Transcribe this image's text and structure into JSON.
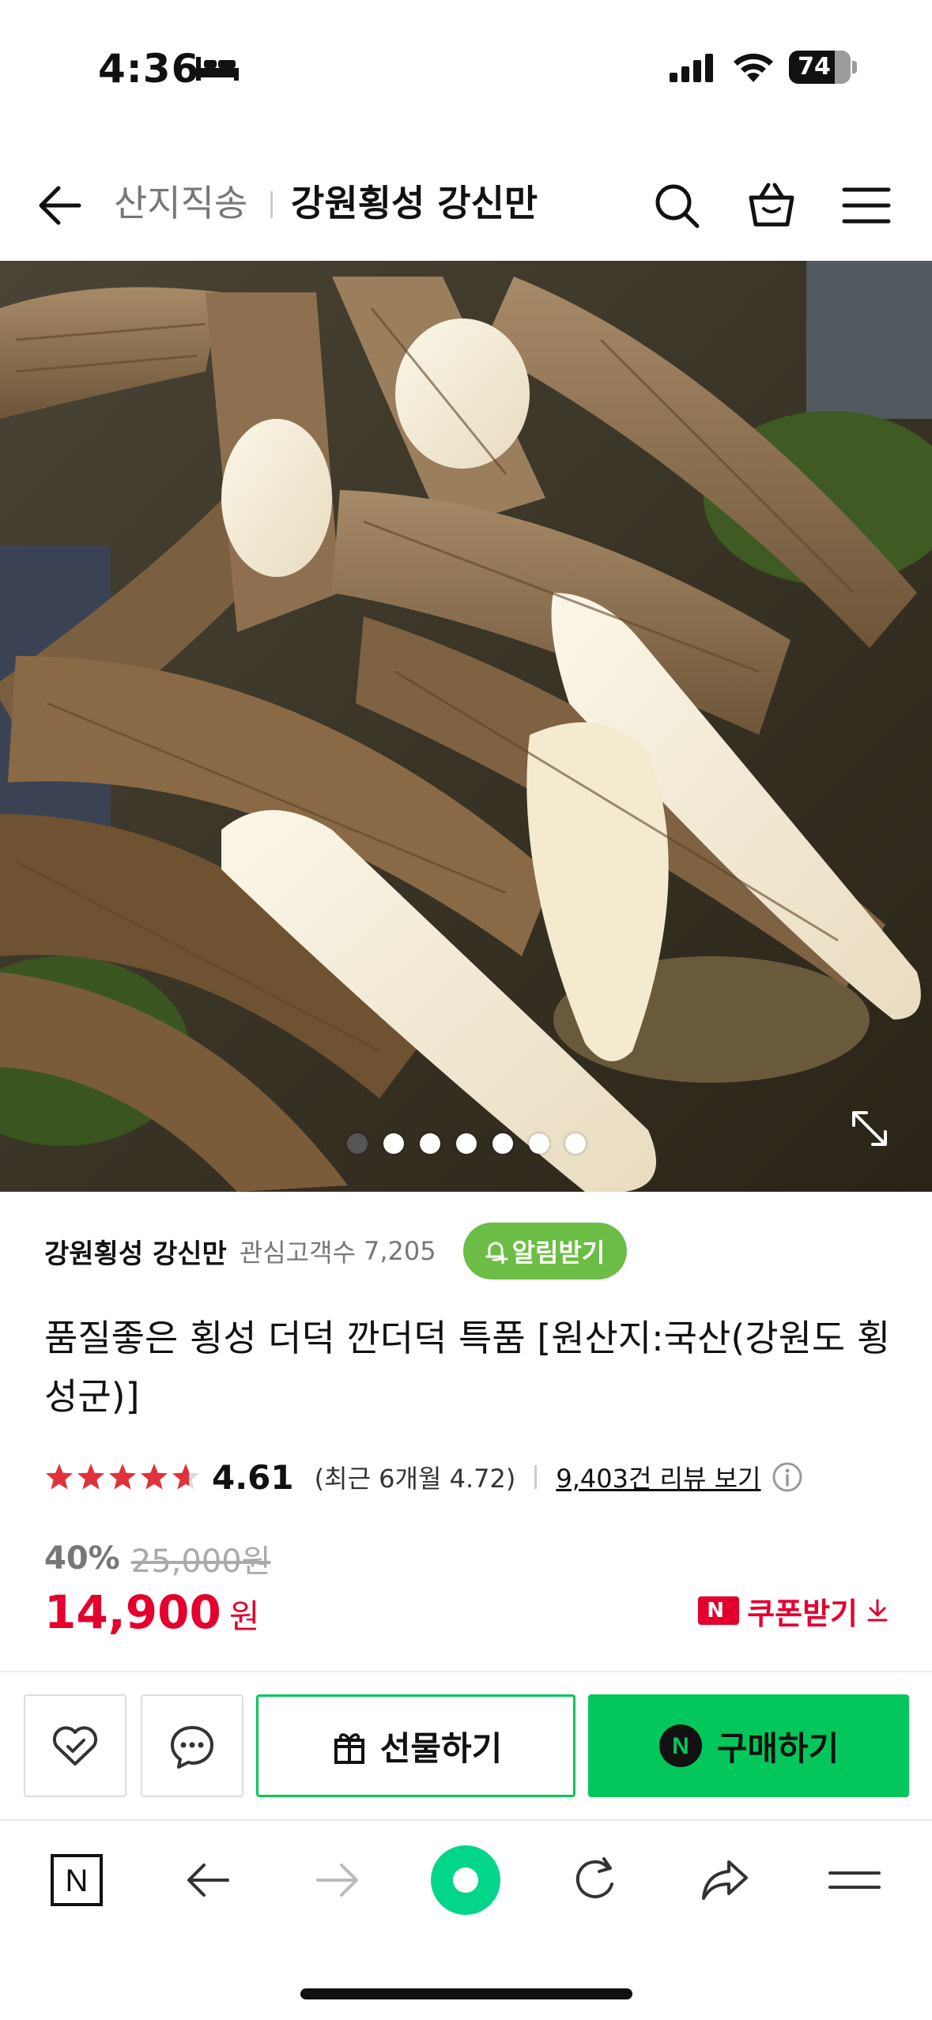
{
  "status_bar": {
    "time": "4:36",
    "battery_level": "74",
    "battery_fraction": 0.74,
    "icons": [
      "bed-icon",
      "cellular-signal-icon",
      "wifi-icon",
      "battery-icon"
    ]
  },
  "header": {
    "channel_label": "산지직송",
    "store_title": "강원횡성 강신만",
    "icons": [
      "back-arrow-icon",
      "search-icon",
      "shopping-bag-icon",
      "hamburger-menu-icon"
    ]
  },
  "gallery": {
    "image_subject": "deodeok roots",
    "total_images": 7,
    "active_index": 0,
    "expand_icon": "expand-icon"
  },
  "store": {
    "name": "강원횡성 강신만",
    "followers_label": "관심고객수",
    "followers_count": "7,205",
    "alert_button": "알림받기"
  },
  "product": {
    "title": "품질좋은 횡성 더덕 깐더덕 특품 [원산지:국산(강원도 횡성군)]",
    "rating": {
      "stars": 4.61,
      "value": "4.61",
      "recent": "(최근 6개월 4.72)",
      "review_link": "9,403건 리뷰 보기"
    },
    "price": {
      "discount_rate": "40%",
      "original_price": "25,000원",
      "sale_price": "14,900",
      "sale_unit": "원",
      "coupon_badge": "N",
      "coupon_label": "쿠폰받기"
    }
  },
  "actions": {
    "gift_label": "선물하기",
    "buy_badge": "N",
    "buy_label": "구매하기"
  },
  "browser_nav": {
    "home_label": "N",
    "items": [
      "naver-home-icon",
      "back-icon",
      "forward-icon",
      "green-dot-icon",
      "refresh-icon",
      "share-icon",
      "menu-icon"
    ]
  },
  "colors": {
    "accent_green": "#03c75a",
    "alert_green": "#6bbd45",
    "price_red": "#e3002d",
    "star_red": "#e0323c"
  }
}
